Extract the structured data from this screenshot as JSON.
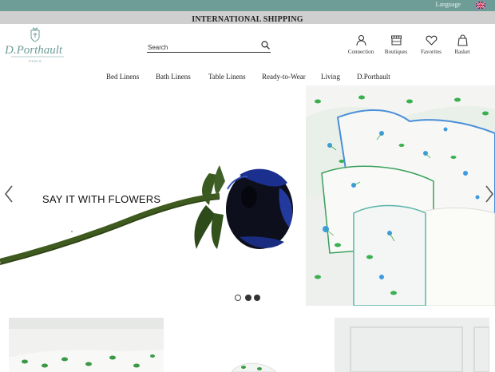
{
  "topbar": {
    "language_label": "Language",
    "flag_icon": "uk-flag-icon",
    "color": "#6e9c97"
  },
  "shipping": {
    "text": "INTERNATIONAL SHIPPING"
  },
  "brand": {
    "logo_text": "D.Porthault",
    "logo_subtext": "PARIS"
  },
  "search": {
    "placeholder": "Search",
    "value": ""
  },
  "utility": [
    {
      "label": "Connection",
      "icon": "user-icon"
    },
    {
      "label": "Boutiques",
      "icon": "storefront-icon"
    },
    {
      "label": "Favorites",
      "icon": "heart-icon"
    },
    {
      "label": "Basket",
      "icon": "bag-icon"
    }
  ],
  "nav": [
    {
      "label": "Bed Linens"
    },
    {
      "label": "Bath Linens"
    },
    {
      "label": "Table Linens"
    },
    {
      "label": "Ready-to-Wear"
    },
    {
      "label": "Living"
    },
    {
      "label": "D.Porthault"
    }
  ],
  "hero": {
    "headline": "SAY IT WITH FLOWERS",
    "slides_total": 3,
    "active_slide": 1
  }
}
